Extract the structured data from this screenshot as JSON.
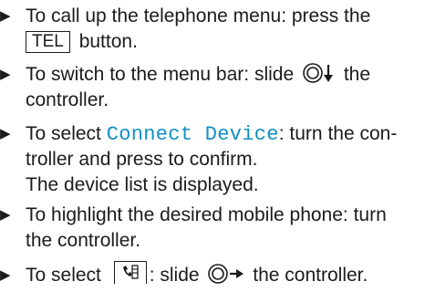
{
  "colors": {
    "menu_item": "#0f8fc4",
    "text": "#1b1b1b"
  },
  "steps": [
    {
      "line1_before": "To call up the telephone menu: press the",
      "key": "TEL",
      "line2_after": " button."
    },
    {
      "before": "To switch to the menu bar: slide ",
      "control_icon": "controller-slide-down-icon",
      "after": " the",
      "line2": "controller."
    },
    {
      "before": "To select ",
      "menu_item": "Connect Device",
      "after": ": turn the con-",
      "line2": "troller and press to confirm.",
      "line3": "The device list is displayed."
    },
    {
      "line1": "To highlight the desired mobile phone: turn",
      "line2": "the controller."
    },
    {
      "before": "To select ",
      "key_icon": "phonebook-icon",
      "middle": ": slide ",
      "control_icon": "controller-slide-right-icon",
      "after": " the controller."
    }
  ]
}
